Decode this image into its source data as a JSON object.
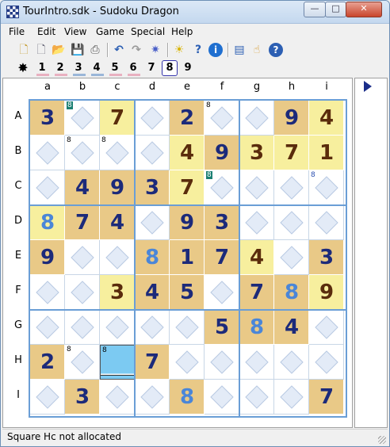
{
  "window": {
    "title": "TourIntro.sdk - Sudoku Dragon",
    "minimize_label": "—",
    "maximize_label": "□",
    "close_label": "✕"
  },
  "menu": [
    "File",
    "Edit",
    "View",
    "Game",
    "Special",
    "Help"
  ],
  "toolbar": {
    "icons": [
      "new-icon",
      "blank-icon",
      "open-icon",
      "save-icon",
      "print-icon",
      "undo-icon",
      "redo-icon",
      "settings-icon",
      "hint-icon",
      "help-question-icon",
      "info-icon",
      "notes-icon",
      "hand-icon",
      "about-icon"
    ],
    "number_buttons": [
      "1",
      "2",
      "3",
      "4",
      "5",
      "6",
      "7",
      "8",
      "9"
    ],
    "selected_number": "8",
    "all_label": "✸"
  },
  "board": {
    "columns": [
      "a",
      "b",
      "c",
      "d",
      "e",
      "f",
      "g",
      "h",
      "i"
    ],
    "rows": [
      "A",
      "B",
      "C",
      "D",
      "E",
      "F",
      "G",
      "H",
      "I"
    ],
    "cells": [
      [
        "3",
        "",
        "7",
        "",
        "2",
        "",
        "",
        "9",
        "4"
      ],
      [
        "",
        "",
        "",
        "",
        "4",
        "9",
        "3",
        "7",
        "1"
      ],
      [
        "",
        "4",
        "9",
        "3",
        "7",
        "",
        "",
        "",
        ""
      ],
      [
        "8",
        "7",
        "4",
        "",
        "9",
        "3",
        "",
        "",
        ""
      ],
      [
        "9",
        "",
        "",
        "8",
        "1",
        "7",
        "4",
        "",
        "3"
      ],
      [
        "",
        "",
        "3",
        "4",
        "5",
        "",
        "7",
        "8",
        "9"
      ],
      [
        "",
        "",
        "",
        "",
        "",
        "5",
        "8",
        "4",
        ""
      ],
      [
        "2",
        "",
        "",
        "7",
        "",
        "",
        "",
        "",
        ""
      ],
      [
        "",
        "3",
        "",
        "",
        "8",
        "",
        "",
        "",
        "7"
      ]
    ],
    "candidates": {
      "Ab": "8",
      "Af": "8",
      "Bb": "8",
      "Bc": "8",
      "Cf": "8",
      "Ci": "8",
      "Hb": "8",
      "Hc": "8"
    },
    "selected_cell": "Hc",
    "colors": {
      "given_bg": "#e9c987",
      "entered_bg": "#f7ef9e",
      "blue_digit": "#4a86d8",
      "dark_digit": "#1c2a7a",
      "brown_digit": "#5a2c0c",
      "selected_bg": "#7ccaf2",
      "grid_line": "#6a9ed6"
    }
  },
  "status": {
    "message": "Square Hc not allocated"
  }
}
